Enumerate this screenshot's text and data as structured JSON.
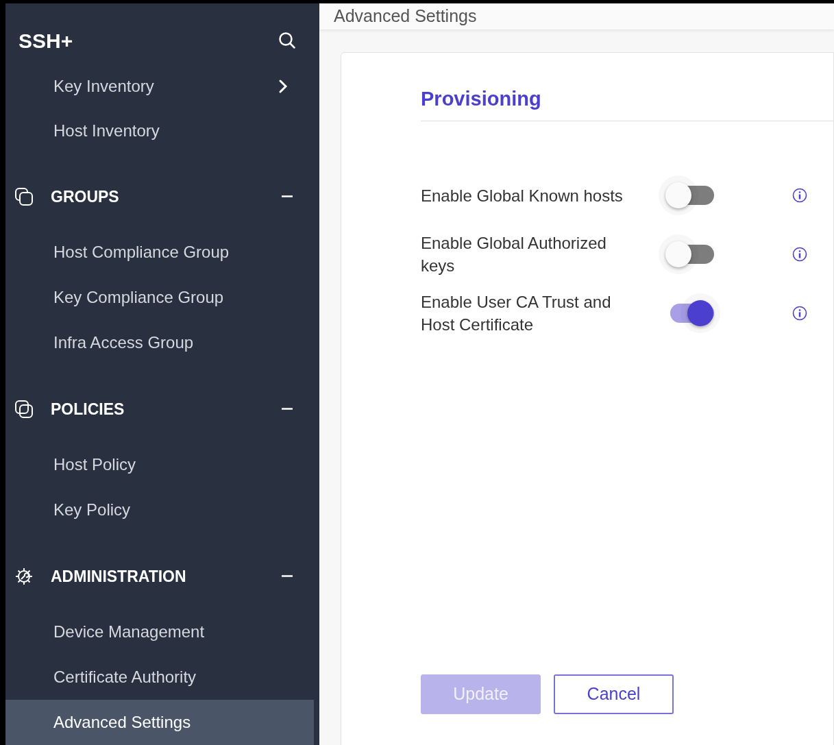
{
  "sidebar": {
    "brand": "SSH+",
    "items": [
      {
        "label": "Key Inventory",
        "has_children": true,
        "selected": false
      },
      {
        "label": "Host Inventory",
        "has_children": false,
        "selected": false
      }
    ],
    "sections": [
      {
        "title": "GROUPS",
        "kind": "squares",
        "expanded": true,
        "items": [
          {
            "label": "Host Compliance Group",
            "selected": false
          },
          {
            "label": "Key Compliance Group",
            "selected": false
          },
          {
            "label": "Infra Access Group",
            "selected": false
          }
        ]
      },
      {
        "title": "POLICIES",
        "kind": "overlap",
        "expanded": true,
        "items": [
          {
            "label": "Host Policy",
            "selected": false
          },
          {
            "label": "Key Policy",
            "selected": false
          }
        ]
      },
      {
        "title": "ADMINISTRATION",
        "kind": "gear",
        "expanded": true,
        "items": [
          {
            "label": "Device Management",
            "selected": false
          },
          {
            "label": "Certificate Authority",
            "selected": false
          },
          {
            "label": "Advanced Settings",
            "selected": true
          }
        ]
      }
    ]
  },
  "page": {
    "title": "Advanced Settings"
  },
  "card": {
    "title": "Provisioning",
    "settings": [
      {
        "label": "Enable Global Known hosts",
        "on": false
      },
      {
        "label": "Enable Global Authorized keys",
        "on": false
      },
      {
        "label": "Enable User CA Trust and Host Certificate",
        "on": true
      }
    ],
    "buttons": [
      {
        "label": "Update",
        "kind": "primary",
        "disabled": true
      },
      {
        "label": "Cancel",
        "kind": "secondary",
        "disabled": false
      }
    ]
  }
}
